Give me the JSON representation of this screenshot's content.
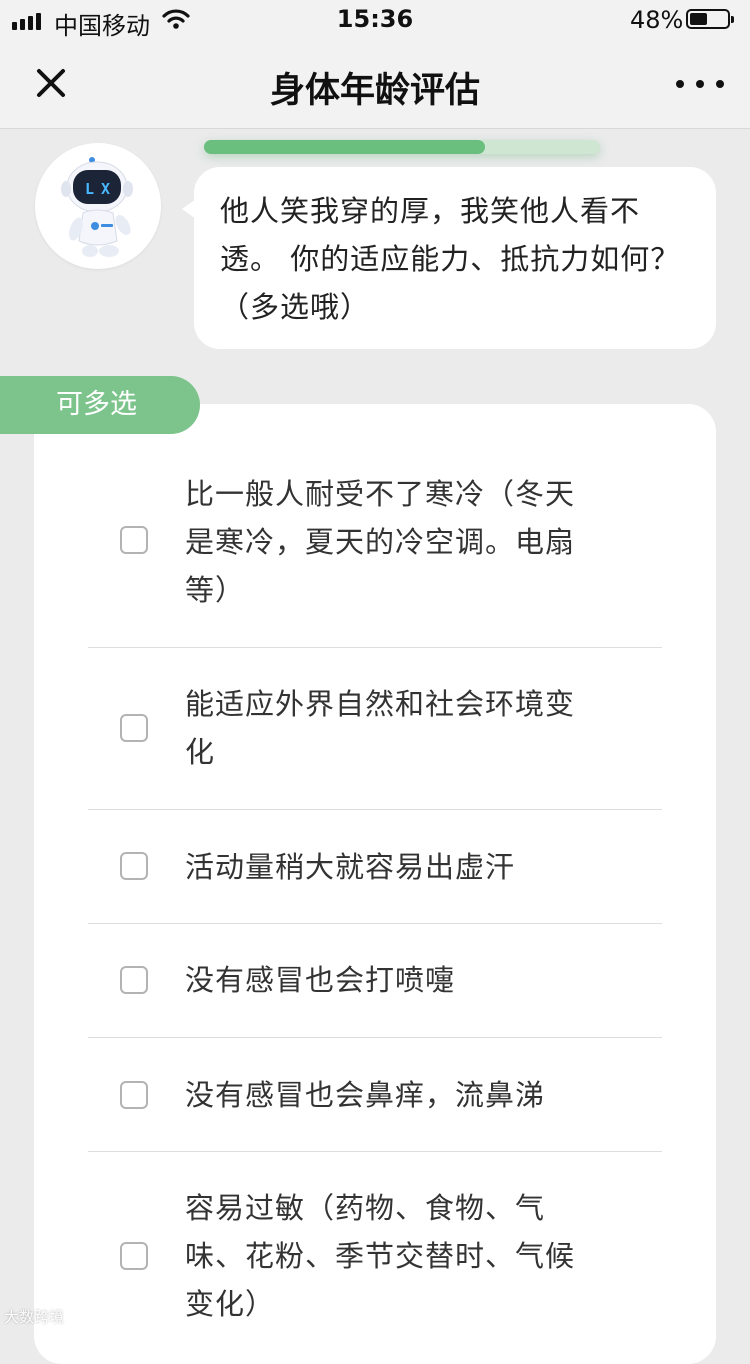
{
  "status_bar": {
    "carrier": "中国移动",
    "time": "15:36",
    "battery_percent": "48%",
    "battery_level": 0.48,
    "signal_icon": "cellular-signal-icon",
    "wifi_icon": "wifi-icon",
    "battery_icon": "battery-icon"
  },
  "nav": {
    "title": "身体年龄评估",
    "close_icon": "close-icon",
    "more_icon": "more-dots-icon"
  },
  "progress": {
    "value": 0.71
  },
  "question": {
    "avatar": "robot-avatar",
    "text": "他人笑我穿的厚，我笑他人看不透。 你的适应能力、抵抗力如何？（多选哦）"
  },
  "multi_select_tag": "可多选",
  "options": [
    {
      "label": "比一般人耐受不了寒冷（冬天是寒冷，夏天的冷空调。电扇等）",
      "checked": false
    },
    {
      "label": "能适应外界自然和社会环境变化",
      "checked": false
    },
    {
      "label": "活动量稍大就容易出虚汗",
      "checked": false
    },
    {
      "label": "没有感冒也会打喷嚏",
      "checked": false
    },
    {
      "label": "没有感冒也会鼻痒，流鼻涕",
      "checked": false
    },
    {
      "label": "容易过敏（药物、食物、气味、花粉、季节交替时、气候变化）",
      "checked": false
    }
  ],
  "watermark": "大数跨境",
  "colors": {
    "accent": "#7cc48c",
    "progress": "#6bbf7e",
    "background": "#ebebec"
  }
}
